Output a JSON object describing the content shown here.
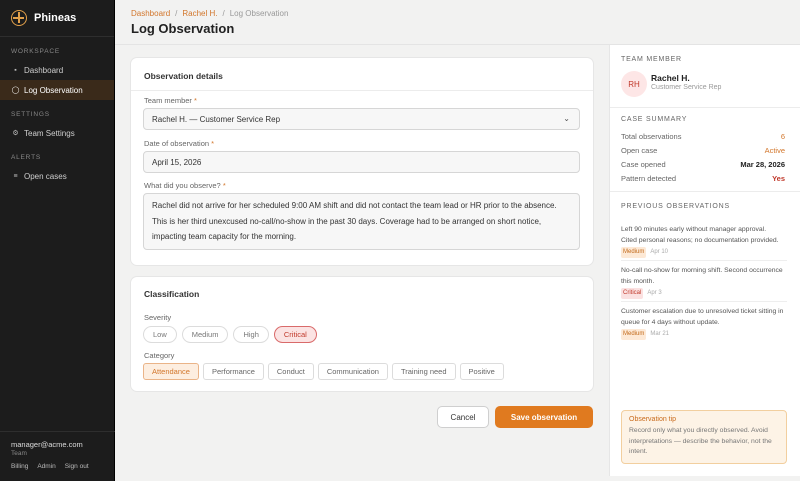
{
  "brand": {
    "name": "Phineas"
  },
  "sidebar": {
    "sections": [
      {
        "title": "WORKSPACE",
        "items": [
          {
            "label": "Dashboard",
            "icon": "grid-icon"
          },
          {
            "label": "Log Observation",
            "icon": "circle-icon",
            "active": true
          }
        ]
      },
      {
        "title": "SETTINGS",
        "items": [
          {
            "label": "Team Settings",
            "icon": "gear-icon"
          }
        ]
      },
      {
        "title": "ALERTS",
        "items": [
          {
            "label": "Open cases",
            "icon": "list-icon"
          }
        ]
      }
    ],
    "footer": {
      "email": "manager@acme.com",
      "role": "Team",
      "links": [
        "Billing",
        "Admin",
        "Sign out"
      ]
    }
  },
  "header": {
    "breadcrumb": [
      "Dashboard",
      "Rachel H.",
      "Log Observation"
    ],
    "separator": "/",
    "title": "Log Observation"
  },
  "details": {
    "title": "Observation details",
    "member_label": "Team member",
    "member_value": "Rachel H. — Customer Service Rep",
    "date_label": "Date of observation",
    "date_value": "April 15, 2026",
    "observe_label": "What did you observe?",
    "observe_lines": [
      "Rachel did not arrive for her scheduled 9:00 AM shift and did not contact the team lead or HR prior to the absence.",
      "This is her third unexcused no-call/no-show in the past 30 days. Coverage had to be arranged on short notice,",
      "impacting team capacity for the morning."
    ],
    "required_mark": "*"
  },
  "classification": {
    "title": "Classification",
    "severity_label": "Severity",
    "severity": [
      "Low",
      "Medium",
      "High",
      "Critical"
    ],
    "severity_selected": "Critical",
    "category_label": "Category",
    "categories": [
      "Attendance",
      "Performance",
      "Conduct",
      "Communication",
      "Training need",
      "Positive"
    ],
    "category_selected": "Attendance"
  },
  "actions": {
    "cancel": "Cancel",
    "save": "Save observation"
  },
  "panel": {
    "member_title": "TEAM MEMBER",
    "initials": "RH",
    "name": "Rachel H.",
    "role": "Customer Service Rep",
    "summary_title": "CASE SUMMARY",
    "summary": [
      {
        "label": "Total observations",
        "value": "6"
      },
      {
        "label": "Open case",
        "value": "Active"
      },
      {
        "label": "Case opened",
        "value": "Mar 28, 2026"
      },
      {
        "label": "Pattern detected",
        "value": "Yes"
      }
    ],
    "previous_title": "PREVIOUS OBSERVATIONS",
    "previous": [
      {
        "lines": [
          "Left 90 minutes early without manager approval.",
          "Cited personal reasons; no documentation provided."
        ],
        "severity": "Medium",
        "date": "Apr 10"
      },
      {
        "lines": [
          "No-call no-show for morning shift. Second occurrence",
          "this month."
        ],
        "severity": "Critical",
        "date": "Apr 3"
      },
      {
        "lines": [
          "Customer escalation due to unresolved ticket sitting in",
          "queue for 4 days without update."
        ],
        "severity": "Medium",
        "date": "Mar 21"
      }
    ],
    "tip_title": "Observation tip",
    "tip_lines": [
      "Record only what you directly observed. Avoid",
      "interpretations — describe the behavior, not the",
      "intent."
    ]
  },
  "colors": {
    "accent": "#e07a1f",
    "sidebar": "#1c1c1c",
    "critical": "#c0392b"
  }
}
